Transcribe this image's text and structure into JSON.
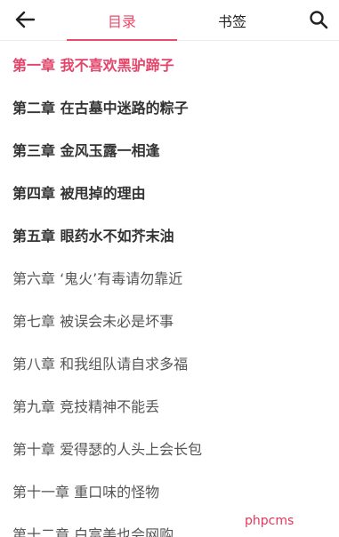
{
  "header": {
    "tabs": [
      {
        "label": "目录",
        "active": true
      },
      {
        "label": "书签",
        "active": false
      }
    ],
    "back_icon": "arrow-left-icon",
    "search_icon": "search-icon"
  },
  "chapters": [
    {
      "title": "第一章 我不喜欢黑驴蹄子",
      "state": "current"
    },
    {
      "title": "第二章 在古墓中迷路的粽子",
      "state": "cached"
    },
    {
      "title": "第三章 金风玉露一相逢",
      "state": "cached"
    },
    {
      "title": "第四章 被甩掉的理由",
      "state": "cached"
    },
    {
      "title": "第五章 眼药水不如芥末油",
      "state": "cached"
    },
    {
      "title": "第六章 ‘鬼火’有毒请勿靠近",
      "state": "normal"
    },
    {
      "title": "第七章 被误会未必是坏事",
      "state": "normal"
    },
    {
      "title": "第八章 和我组队请自求多福",
      "state": "normal"
    },
    {
      "title": "第九章 竞技精神不能丢",
      "state": "normal"
    },
    {
      "title": "第十章 爱得瑟的人头上会长包",
      "state": "normal"
    },
    {
      "title": "第十一章 重口味的怪物",
      "state": "normal"
    },
    {
      "title": "第十二章 白富美也会网购",
      "state": "normal"
    }
  ],
  "watermark": "phpcms",
  "colors": {
    "accent": "#ec4a6a",
    "current_chapter": "#e2446a",
    "cached_chapter": "#333333",
    "normal_chapter": "#555555"
  }
}
